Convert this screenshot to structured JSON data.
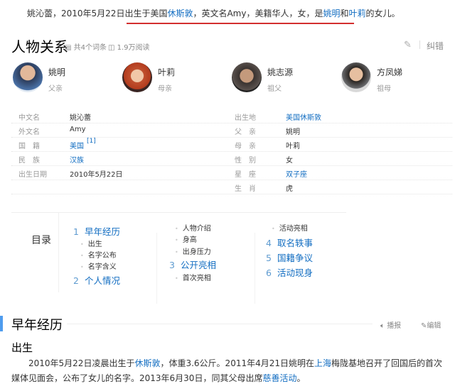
{
  "intro": {
    "p1": "姚沁蕾，2010年5月22日出生于美国",
    "l1": "休斯敦",
    "p2": "，英文名Amy，美籍华人，女，是",
    "l2": "姚明",
    "p3": "和",
    "l3": "叶莉",
    "p4": "的女儿。"
  },
  "relations": {
    "title": "人物关系",
    "entries": "共4个词条",
    "reads": "1.9万阅读",
    "correct": "纠错",
    "people": [
      {
        "name": "姚明",
        "relation": "父亲"
      },
      {
        "name": "叶莉",
        "relation": "母亲"
      },
      {
        "name": "姚志源",
        "relation": "祖父"
      },
      {
        "name": "方凤娣",
        "relation": "祖母"
      }
    ]
  },
  "info": {
    "left": [
      {
        "label": "中文名",
        "value": "姚沁蕾"
      },
      {
        "label": "外文名",
        "value": "Amy"
      },
      {
        "label": "国　籍",
        "value": "美国",
        "ref": "[1]"
      },
      {
        "label": "民　族",
        "value": "汉族"
      },
      {
        "label": "出生日期",
        "value": "2010年5月22日"
      }
    ],
    "right": [
      {
        "label": "出生地",
        "value": "美国休斯敦"
      },
      {
        "label": "父　亲",
        "value": "姚明"
      },
      {
        "label": "母　亲",
        "value": "叶莉"
      },
      {
        "label": "性　别",
        "value": "女"
      },
      {
        "label": "星　座",
        "value": "双子座"
      },
      {
        "label": "生　肖",
        "value": "虎"
      }
    ]
  },
  "toc": {
    "title": "目录",
    "s1": {
      "num": "1",
      "label": "早年经历",
      "subs": [
        "出生",
        "名字公布",
        "名字含义"
      ]
    },
    "s2": {
      "num": "2",
      "label": "个人情况",
      "subs": [
        "人物介绍",
        "身高",
        "出身压力"
      ]
    },
    "s3": {
      "num": "3",
      "label": "公开亮相",
      "subs": [
        "首次亮相",
        "活动亮相"
      ]
    },
    "s4": {
      "num": "4",
      "label": "取名轶事"
    },
    "s5": {
      "num": "5",
      "label": "国籍争议"
    },
    "s6": {
      "num": "6",
      "label": "活动现身"
    }
  },
  "section": {
    "title": "早年经历",
    "play": "播报",
    "edit": "编辑",
    "sub": "出生",
    "para": {
      "t1": "2010年5月22日凌晨出生于",
      "l1": "休斯敦",
      "t2": "，体重3.6公斤。2011年4月21日姚明在",
      "l2": "上海",
      "t3": "梅陇基地召开了回国后的首次媒体见面会，公布了女儿的名字。2013年6月30日，同其父母出席",
      "l3": "慈善活动",
      "t4": "。"
    }
  }
}
